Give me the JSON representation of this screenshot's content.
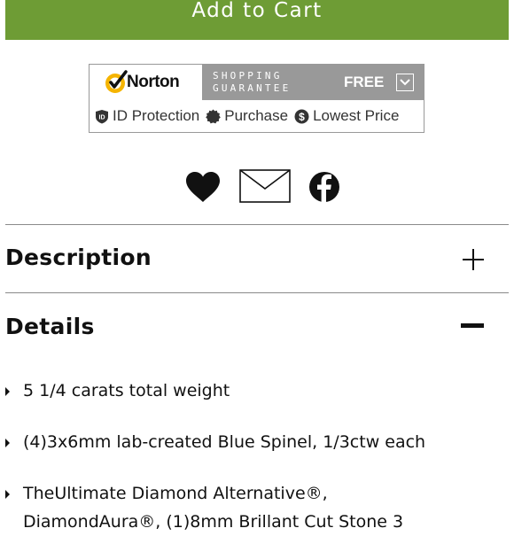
{
  "cart": {
    "button_label": "Add to Cart"
  },
  "norton": {
    "brand": "Norton",
    "guarantee_line1": "SHOPPING",
    "guarantee_line2": "GUARANTEE",
    "free_label": "FREE",
    "features": [
      "ID Protection",
      "Purchase",
      "Lowest Price"
    ],
    "check_color": "#f5b400"
  },
  "share": {
    "icons": [
      "heart-icon",
      "envelope-icon",
      "facebook-icon"
    ]
  },
  "accordion": {
    "description": {
      "title": "Description",
      "state": "collapsed"
    },
    "details": {
      "title": "Details",
      "state": "expanded"
    }
  },
  "details": {
    "items": [
      "5 1/4 carats total weight",
      "(4)3x6mm lab-created Blue Spinel, 1/3ctw each",
      "TheUltimate Diamond Alternative®,",
      "DiamondAura®, (1)8mm Brillant Cut Stone 3"
    ]
  },
  "colors": {
    "cart_green": "#6e9c35",
    "norton_grey": "#999999"
  }
}
